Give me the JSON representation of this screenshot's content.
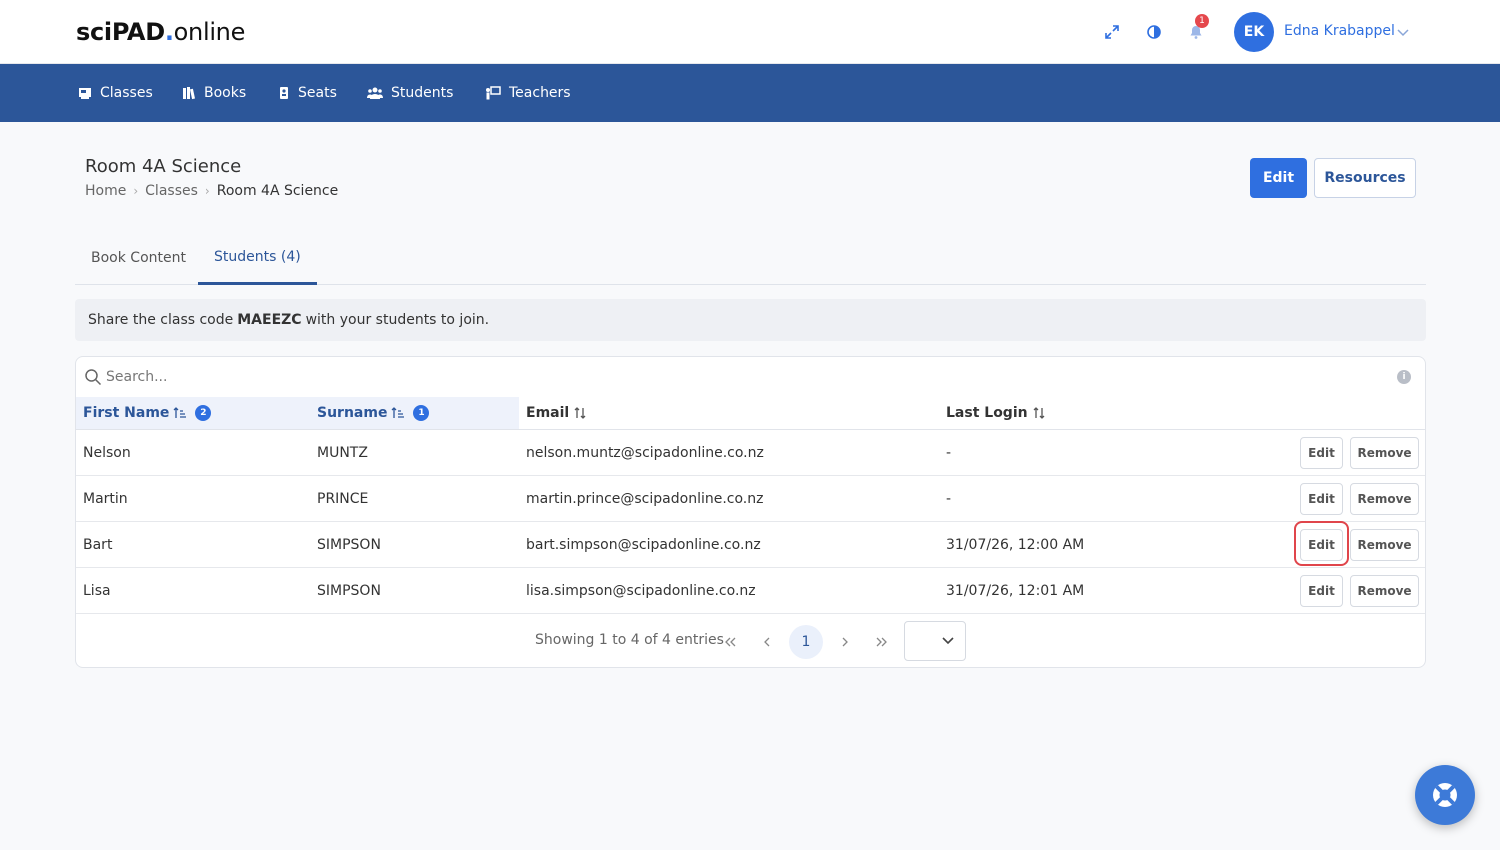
{
  "app": {
    "logo_bold": "sciPAD",
    "logo_dot": ".",
    "logo_rest": "online"
  },
  "header": {
    "notification_count": "1",
    "user_initials": "EK",
    "user_name": "Edna Krabappel"
  },
  "nav": {
    "items": [
      {
        "label": "Classes",
        "icon": "classroom-icon"
      },
      {
        "label": "Books",
        "icon": "books-icon"
      },
      {
        "label": "Seats",
        "icon": "seat-icon"
      },
      {
        "label": "Students",
        "icon": "students-icon"
      },
      {
        "label": "Teachers",
        "icon": "teacher-icon"
      }
    ]
  },
  "page": {
    "title": "Room 4A Science",
    "breadcrumb": [
      "Home",
      "Classes",
      "Room 4A Science"
    ],
    "edit_label": "Edit",
    "resources_label": "Resources"
  },
  "tabs": [
    {
      "label": "Book Content",
      "active": false
    },
    {
      "label": "Students (4)",
      "active": true
    }
  ],
  "info": {
    "prefix": "Share the class code",
    "code": "MAEEZC",
    "suffix": "with your students to join."
  },
  "table": {
    "search_placeholder": "Search...",
    "columns": [
      {
        "label": "First Name",
        "sort_order": "2"
      },
      {
        "label": "Surname",
        "sort_order": "1"
      },
      {
        "label": "Email"
      },
      {
        "label": "Last Login"
      }
    ],
    "rows": [
      {
        "first": "Nelson",
        "surname": "MUNTZ",
        "email": "nelson.muntz@scipadonline.co.nz",
        "last_login": "-"
      },
      {
        "first": "Martin",
        "surname": "PRINCE",
        "email": "martin.prince@scipadonline.co.nz",
        "last_login": "-"
      },
      {
        "first": "Bart",
        "surname": "SIMPSON",
        "email": "bart.simpson@scipadonline.co.nz",
        "last_login": "31/07/26, 12:00 AM"
      },
      {
        "first": "Lisa",
        "surname": "SIMPSON",
        "email": "lisa.simpson@scipadonline.co.nz",
        "last_login": "31/07/26, 12:01 AM"
      }
    ],
    "edit_label": "Edit",
    "remove_label": "Remove"
  },
  "pagination": {
    "info": "Showing 1 to 4 of 4 entries",
    "current_page": "1"
  },
  "colors": {
    "primary": "#2f6fe0",
    "nav_bg": "#2c5699",
    "highlight": "#e0454b"
  }
}
